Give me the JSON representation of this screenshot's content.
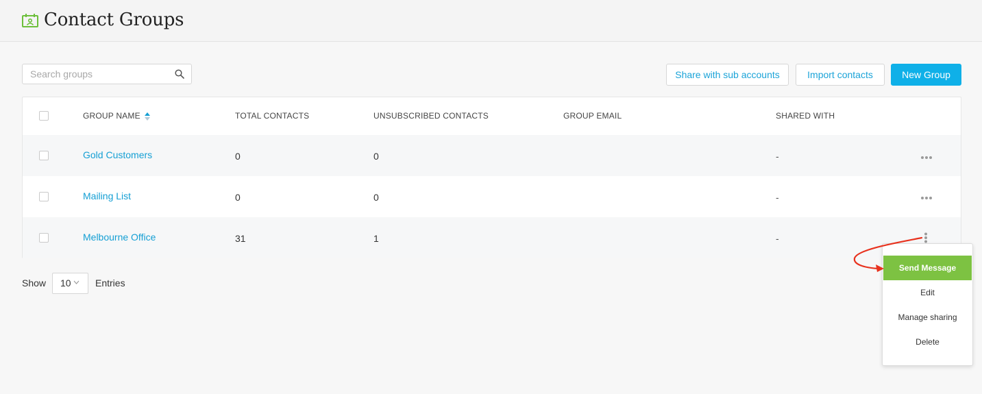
{
  "page": {
    "title": "Contact Groups",
    "icon": "contacts-calendar-icon"
  },
  "toolbar": {
    "search_placeholder": "Search groups",
    "share_label": "Share with sub accounts",
    "import_label": "Import contacts",
    "new_group_label": "New Group"
  },
  "table": {
    "columns": [
      "GROUP NAME",
      "TOTAL CONTACTS",
      "UNSUBSCRIBED CONTACTS",
      "GROUP EMAIL",
      "SHARED WITH"
    ],
    "rows": [
      {
        "name": "Gold Customers",
        "total": "0",
        "unsubscribed": "0",
        "email": "",
        "shared": "-"
      },
      {
        "name": "Mailing List",
        "total": "0",
        "unsubscribed": "0",
        "email": "",
        "shared": "-"
      },
      {
        "name": "Melbourne Office",
        "total": "31",
        "unsubscribed": "1",
        "email": "",
        "shared": "-"
      }
    ]
  },
  "footer": {
    "show_label": "Show",
    "page_size": "10",
    "entries_label": "Entries"
  },
  "context_menu": {
    "items": [
      "Send Message",
      "Edit",
      "Manage sharing",
      "Delete"
    ]
  },
  "colors": {
    "primary": "#0fb0e8",
    "link": "#149fd4",
    "menu_active": "#7dc242",
    "arrow": "#e8321e",
    "icon_green": "#6cbf3a"
  }
}
